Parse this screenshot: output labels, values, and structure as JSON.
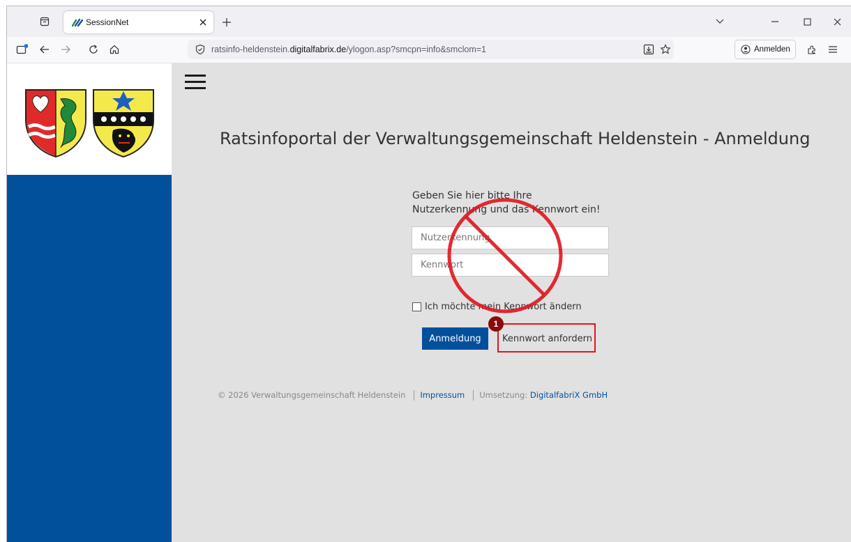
{
  "browser": {
    "tab_title": "SessionNet",
    "url_prefix": "ratsinfo-heldenstein.",
    "url_domain": "digitalfabrix.de",
    "url_path": "/ylogon.asp?smcpn=info&smclom=1",
    "signin_label": "Anmelden",
    "icons": [
      "tab-list-icon",
      "close-icon",
      "plus-icon",
      "chevron-down-icon",
      "minimize-icon",
      "maximize-icon",
      "close-window-icon",
      "sidebar-icon",
      "back-icon",
      "forward-icon",
      "reload-icon",
      "home-icon",
      "shield-icon",
      "install-icon",
      "star-icon",
      "account-icon",
      "extensions-icon",
      "menu-icon"
    ]
  },
  "page": {
    "title": "Ratsinfoportal der Verwaltungsgemeinschaft Heldenstein - Anmeldung",
    "instruction_line1": "Geben Sie hier bitte Ihre",
    "instruction_line2": "Nutzerkennung und das Kennwort ein!",
    "username_placeholder": "Nutzerkennung",
    "password_placeholder": "Kennwort",
    "change_password_label": "Ich möchte mein Kennwort ändern",
    "login_button": "Anmeldung",
    "request_password_link": "Kennwort anfordern",
    "annotation_number": "1"
  },
  "footer": {
    "copyright": "© 2026 Verwaltungsgemeinschaft Heldenstein",
    "imprint": "Impressum",
    "implementation_label": "Umsetzung: ",
    "implementation_link": "DigitalfabriX GmbH"
  },
  "colors": {
    "brand_blue": "#01509c",
    "content_bg": "#e1e1e1",
    "annotation_red": "#e0141e",
    "badge": "#8a0b0b"
  }
}
